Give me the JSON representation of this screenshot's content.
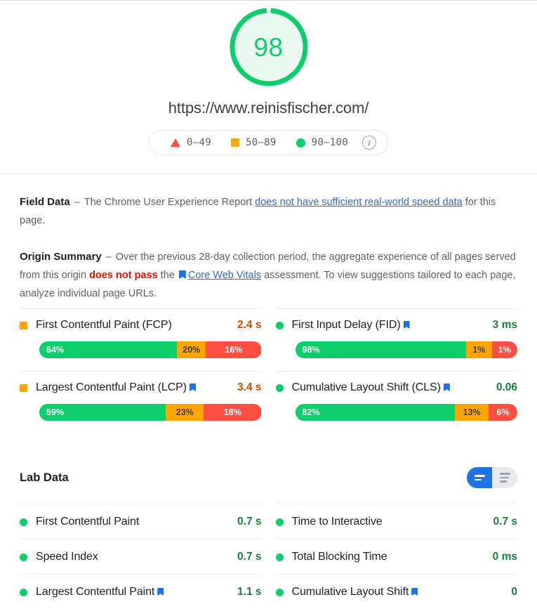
{
  "score": {
    "value": "98",
    "color": "#0cce6b",
    "percent": 98
  },
  "page_url": "https://www.reinisfischer.com/",
  "legend": {
    "items": [
      {
        "icon": "triangle-fail-icon",
        "label": "0–49",
        "color": "#ff4e42"
      },
      {
        "icon": "square-average-icon",
        "label": "50–89",
        "color": "#ffa400"
      },
      {
        "icon": "circle-pass-icon",
        "label": "90–100",
        "color": "#0cce6b"
      }
    ],
    "info_label": "i"
  },
  "field_data": {
    "title": "Field Data",
    "dash": "–",
    "text_before": "The Chrome User Experience Report ",
    "link_text": "does not have sufficient real-world speed data",
    "text_after": " for this page."
  },
  "origin_summary": {
    "title": "Origin Summary",
    "dash": "–",
    "text_1": "Over the previous 28-day collection period, the aggregate experience of all pages served from this origin ",
    "fail_text": "does not pass",
    "text_2": " the ",
    "cwv_link": "Core Web Vitals",
    "text_3": " assessment. To view suggestions tailored to each page, analyze individual page URLs."
  },
  "field_metrics": [
    {
      "name": "First Contentful Paint (FCP)",
      "status": "average",
      "status_icon": "square-average-icon",
      "has_flag": false,
      "value": "2.4 s",
      "value_class": "v-orange",
      "distribution": [
        {
          "label": "64%",
          "percent": 64,
          "bucket": "good"
        },
        {
          "label": "20%",
          "percent": 20,
          "bucket": "average"
        },
        {
          "label": "16%",
          "percent": 16,
          "bucket": "poor"
        }
      ]
    },
    {
      "name": "First Input Delay (FID)",
      "status": "good",
      "status_icon": "circle-pass-icon",
      "has_flag": true,
      "value": "3 ms",
      "value_class": "v-green",
      "distribution": [
        {
          "label": "98%",
          "percent": 98,
          "bucket": "good"
        },
        {
          "label": "1%",
          "percent": 1,
          "bucket": "average"
        },
        {
          "label": "1%",
          "percent": 1,
          "bucket": "poor"
        }
      ]
    },
    {
      "name": "Largest Contentful Paint (LCP)",
      "status": "average",
      "status_icon": "square-average-icon",
      "has_flag": true,
      "value": "3.4 s",
      "value_class": "v-orange",
      "distribution": [
        {
          "label": "59%",
          "percent": 59,
          "bucket": "good"
        },
        {
          "label": "23%",
          "percent": 23,
          "bucket": "average"
        },
        {
          "label": "18%",
          "percent": 18,
          "bucket": "poor"
        }
      ]
    },
    {
      "name": "Cumulative Layout Shift (CLS)",
      "status": "good",
      "status_icon": "circle-pass-icon",
      "has_flag": true,
      "value": "0.06",
      "value_class": "v-green",
      "distribution": [
        {
          "label": "82%",
          "percent": 82,
          "bucket": "good"
        },
        {
          "label": "13%",
          "percent": 13,
          "bucket": "average"
        },
        {
          "label": "6%",
          "percent": 6,
          "bucket": "poor"
        }
      ]
    }
  ],
  "lab_data": {
    "title": "Lab Data",
    "toggle": {
      "active_icon": "list-view-icon",
      "inactive_icon": "detail-view-icon"
    },
    "metrics": [
      {
        "name": "First Contentful Paint",
        "status": "good",
        "has_flag": false,
        "value": "0.7 s"
      },
      {
        "name": "Time to Interactive",
        "status": "good",
        "has_flag": false,
        "value": "0.7 s"
      },
      {
        "name": "Speed Index",
        "status": "good",
        "has_flag": false,
        "value": "0.7 s"
      },
      {
        "name": "Total Blocking Time",
        "status": "good",
        "has_flag": false,
        "value": "0 ms"
      },
      {
        "name": "Largest Contentful Paint",
        "status": "good",
        "has_flag": true,
        "value": "1.1 s"
      },
      {
        "name": "Cumulative Layout Shift",
        "status": "good",
        "has_flag": true,
        "value": "0"
      }
    ]
  },
  "colors": {
    "good": "#0cce6b",
    "average": "#ffa400",
    "poor": "#ff4e42",
    "link": "#3367d6",
    "flag": "#1a73e8",
    "value_good": "#178239",
    "value_average": "#d04c00"
  }
}
